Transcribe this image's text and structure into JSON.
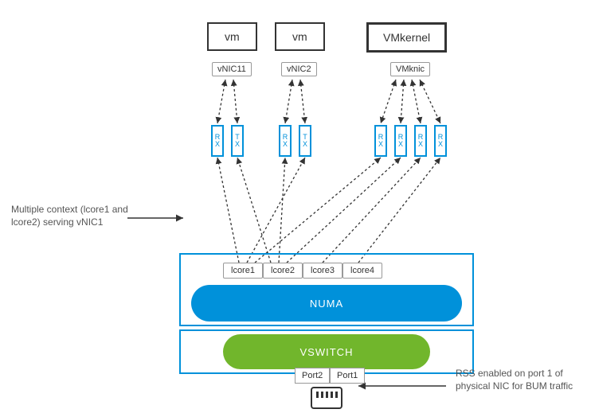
{
  "top": {
    "vm1": "vm",
    "vm2": "vm",
    "vmk": "VMkernel",
    "vnic1": "vNIC11",
    "vnic2": "vNIC2",
    "vmknic": "VMknic"
  },
  "queues": {
    "rx": "R\nX",
    "tx": "T\nX"
  },
  "lcores": {
    "l1": "lcore1",
    "l2": "lcore2",
    "l3": "lcore3",
    "l4": "lcore4"
  },
  "numa": "NUMA",
  "vswitch": "VSWITCH",
  "ports": {
    "p1": "Port1",
    "p2": "Port2"
  },
  "left_note": "Multiple context (lcore1 and lcore2) serving vNIC1",
  "right_note": "RSS enabled on port 1 of physical NIC for BUM traffic",
  "chart_data": {
    "type": "diagram",
    "boxes": [
      {
        "id": "vm1",
        "label": "vm"
      },
      {
        "id": "vm2",
        "label": "vm"
      },
      {
        "id": "vmkernel",
        "label": "VMkernel"
      },
      {
        "id": "vnic11",
        "label": "vNIC11",
        "parent": "vm1"
      },
      {
        "id": "vnic2",
        "label": "vNIC2",
        "parent": "vm2"
      },
      {
        "id": "vmknic",
        "label": "VMknic",
        "parent": "vmkernel"
      },
      {
        "id": "q_rx1",
        "label": "RX",
        "group": "vnic11"
      },
      {
        "id": "q_tx1",
        "label": "TX",
        "group": "vnic11"
      },
      {
        "id": "q_rx2",
        "label": "RX",
        "group": "vnic2"
      },
      {
        "id": "q_tx2",
        "label": "TX",
        "group": "vnic2"
      },
      {
        "id": "q_k_rx_a",
        "label": "RX",
        "group": "vmknic"
      },
      {
        "id": "q_k_rx_b",
        "label": "RX",
        "group": "vmknic"
      },
      {
        "id": "q_k_rx_c",
        "label": "RX",
        "group": "vmknic"
      },
      {
        "id": "q_k_rx_d",
        "label": "RX",
        "group": "vmknic"
      },
      {
        "id": "lcore1",
        "label": "lcore1",
        "parent": "numa"
      },
      {
        "id": "lcore2",
        "label": "lcore2",
        "parent": "numa"
      },
      {
        "id": "lcore3",
        "label": "lcore3",
        "parent": "numa"
      },
      {
        "id": "lcore4",
        "label": "lcore4",
        "parent": "numa"
      },
      {
        "id": "numa",
        "label": "NUMA"
      },
      {
        "id": "vswitch",
        "label": "VSWITCH"
      },
      {
        "id": "port1",
        "label": "Port1",
        "parent": "vswitch"
      },
      {
        "id": "port2",
        "label": "Port2",
        "parent": "vswitch"
      },
      {
        "id": "pnic",
        "label": "physical NIC"
      }
    ],
    "links": [
      {
        "from": "vnic11",
        "to": "q_rx1",
        "style": "dashed-bidir"
      },
      {
        "from": "vnic11",
        "to": "q_tx1",
        "style": "dashed-bidir"
      },
      {
        "from": "vnic2",
        "to": "q_rx2",
        "style": "dashed-bidir"
      },
      {
        "from": "vnic2",
        "to": "q_tx2",
        "style": "dashed-bidir"
      },
      {
        "from": "vmknic",
        "to": "q_k_rx_a",
        "style": "dashed-bidir"
      },
      {
        "from": "vmknic",
        "to": "q_k_rx_b",
        "style": "dashed-bidir"
      },
      {
        "from": "vmknic",
        "to": "q_k_rx_c",
        "style": "dashed-bidir"
      },
      {
        "from": "vmknic",
        "to": "q_k_rx_d",
        "style": "dashed-bidir"
      },
      {
        "from": "lcore1",
        "to": "q_rx1",
        "style": "dashed"
      },
      {
        "from": "lcore2",
        "to": "q_tx1",
        "style": "dashed"
      },
      {
        "from": "lcore2",
        "to": "q_rx2",
        "style": "dashed"
      },
      {
        "from": "lcore1",
        "to": "q_tx2",
        "style": "dashed"
      },
      {
        "from": "lcore1",
        "to": "q_k_rx_a",
        "style": "dashed"
      },
      {
        "from": "lcore2",
        "to": "q_k_rx_b",
        "style": "dashed"
      },
      {
        "from": "lcore3",
        "to": "q_k_rx_c",
        "style": "dashed"
      },
      {
        "from": "lcore4",
        "to": "q_k_rx_d",
        "style": "dashed"
      },
      {
        "from": "left_note",
        "to": "lcore1",
        "style": "solid-arrow"
      },
      {
        "from": "right_note",
        "to": "pnic",
        "style": "solid-arrow"
      },
      {
        "from": "port1",
        "to": "pnic",
        "style": "implicit"
      },
      {
        "from": "port2",
        "to": "pnic",
        "style": "implicit"
      }
    ]
  }
}
